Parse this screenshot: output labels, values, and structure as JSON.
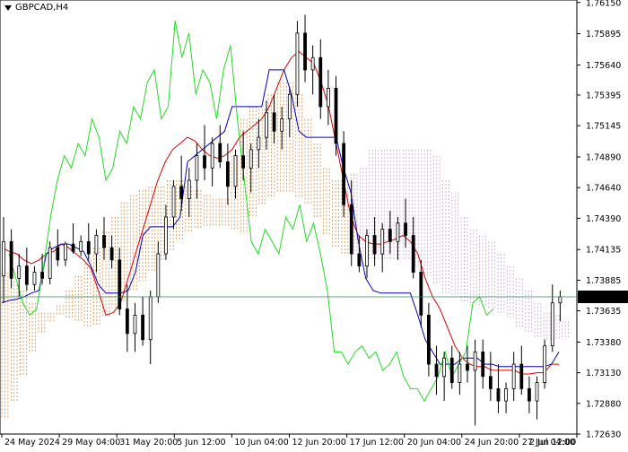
{
  "symbol_label": "GBPCAD,H4",
  "current_price": "1.73749",
  "colors": {
    "candles": "#000000",
    "tenkan": "#e00000",
    "kijun": "#0000c8",
    "chikou": "#22dd22",
    "senkou_a_cloud": "#e08a3c",
    "senkou_b_cloud": "#c8a0c8",
    "price_line": "#2e8b57",
    "price_label_bg": "#000000"
  },
  "chart_data": {
    "type": "line",
    "title": "GBPCAD,H4",
    "xlabel": "",
    "ylabel": "",
    "ylim": [
      1.7263,
      1.7617
    ],
    "y_ticks": [
      "1.76150",
      "1.75895",
      "1.75640",
      "1.75395",
      "1.75145",
      "1.74890",
      "1.74640",
      "1.74390",
      "1.74135",
      "1.73885",
      "1.73635",
      "1.73380",
      "1.73130",
      "1.72880",
      "1.72630"
    ],
    "x_ticks": [
      "24 May 2024",
      "29 May 04:00",
      "31 May 20:00",
      "5 Jun 12:00",
      "10 Jun 04:00",
      "12 Jun 20:00",
      "17 Jun 12:00",
      "20 Jun 04:00",
      "24 Jun 20:00",
      "27 Jun 12:00",
      "2 Jul 04:00"
    ],
    "x_range": [
      0,
      120
    ],
    "series": [
      {
        "values": [
          1.7415,
          1.7412,
          1.741,
          1.7405,
          1.7402,
          1.7405,
          1.741,
          1.7412,
          1.7418,
          1.7415,
          1.741,
          1.7405,
          1.7398,
          1.738,
          1.736,
          1.7362,
          1.737,
          1.739,
          1.741,
          1.743,
          1.745,
          1.747,
          1.7485,
          1.7495,
          1.75,
          1.7505,
          1.7502,
          1.7495,
          1.749,
          1.7488,
          1.749,
          1.7495,
          1.7505,
          1.751,
          1.7515,
          1.752,
          1.753,
          1.7545,
          1.756,
          1.757,
          1.7575,
          1.757,
          1.7565,
          1.755,
          1.753,
          1.75,
          1.747,
          1.744,
          1.7425,
          1.742,
          1.7418,
          1.7418,
          1.742,
          1.7422,
          1.7425,
          1.742,
          1.741,
          1.739,
          1.7375,
          1.7365,
          1.735,
          1.7335,
          1.7325,
          1.732,
          1.7318,
          1.7318,
          1.7315,
          1.7315,
          1.7315,
          1.7315,
          1.7312,
          1.7312,
          1.7313,
          1.7313,
          1.732,
          1.732
        ]
      },
      {
        "values": [
          1.737,
          1.7372,
          1.7373,
          1.7375,
          1.7378,
          1.738,
          1.741,
          1.7415,
          1.7418,
          1.7418,
          1.7415,
          1.7412,
          1.74,
          1.7385,
          1.7378,
          1.7378,
          1.7378,
          1.738,
          1.7395,
          1.7425,
          1.7432,
          1.7432,
          1.7432,
          1.7432,
          1.744,
          1.7485,
          1.749,
          1.7495,
          1.75,
          1.7505,
          1.751,
          1.753,
          1.753,
          1.753,
          1.753,
          1.753,
          1.756,
          1.756,
          1.756,
          1.754,
          1.751,
          1.7505,
          1.7505,
          1.7505,
          1.7505,
          1.7505,
          1.748,
          1.746,
          1.742,
          1.739,
          1.738,
          1.7378,
          1.7378,
          1.7378,
          1.7378,
          1.7378,
          1.736,
          1.734,
          1.733,
          1.732,
          1.732,
          1.732,
          1.7325,
          1.7325,
          1.7325,
          1.732,
          1.732,
          1.7318,
          1.7318,
          1.7318,
          1.7318,
          1.7318,
          1.7318,
          1.7318,
          1.732,
          1.733
        ]
      },
      {
        "values": [
          1.741,
          1.739,
          1.737,
          1.736,
          1.7365,
          1.74,
          1.744,
          1.747,
          1.749,
          1.748,
          1.75,
          1.749,
          1.752,
          1.7505,
          1.747,
          1.748,
          1.751,
          1.75,
          1.753,
          1.752,
          1.755,
          1.756,
          1.752,
          1.753,
          1.76,
          1.757,
          1.759,
          1.754,
          1.756,
          1.755,
          1.752,
          1.756,
          1.758,
          1.752,
          1.747,
          1.742,
          1.741,
          1.743,
          1.742,
          1.741,
          1.744,
          1.743,
          1.745,
          1.742,
          1.7435,
          1.741,
          1.738,
          1.733,
          1.733,
          1.732,
          1.733,
          1.7335,
          1.7325,
          1.733,
          1.7315,
          1.732,
          1.733,
          1.731,
          1.73,
          1.73,
          1.729,
          1.73,
          1.731,
          1.733,
          1.731,
          1.732,
          1.733,
          1.737,
          1.7375,
          1.736,
          1.7365
        ]
      }
    ],
    "candles": [
      {
        "o": 1.7392,
        "h": 1.744,
        "l": 1.737,
        "c": 1.742
      },
      {
        "o": 1.742,
        "h": 1.743,
        "l": 1.7382,
        "c": 1.739
      },
      {
        "o": 1.739,
        "h": 1.741,
        "l": 1.7375,
        "c": 1.74
      },
      {
        "o": 1.74,
        "h": 1.7415,
        "l": 1.738,
        "c": 1.7385
      },
      {
        "o": 1.7385,
        "h": 1.74,
        "l": 1.738,
        "c": 1.7395
      },
      {
        "o": 1.7395,
        "h": 1.741,
        "l": 1.7385,
        "c": 1.739
      },
      {
        "o": 1.739,
        "h": 1.742,
        "l": 1.7385,
        "c": 1.7415
      },
      {
        "o": 1.7415,
        "h": 1.743,
        "l": 1.74,
        "c": 1.7405
      },
      {
        "o": 1.7405,
        "h": 1.742,
        "l": 1.74,
        "c": 1.7418
      },
      {
        "o": 1.7418,
        "h": 1.7435,
        "l": 1.741,
        "c": 1.7412
      },
      {
        "o": 1.7412,
        "h": 1.7425,
        "l": 1.7408,
        "c": 1.742
      },
      {
        "o": 1.742,
        "h": 1.7435,
        "l": 1.7405,
        "c": 1.741
      },
      {
        "o": 1.741,
        "h": 1.743,
        "l": 1.7395,
        "c": 1.7425
      },
      {
        "o": 1.7425,
        "h": 1.744,
        "l": 1.7405,
        "c": 1.7415
      },
      {
        "o": 1.7415,
        "h": 1.7425,
        "l": 1.7398,
        "c": 1.7405
      },
      {
        "o": 1.7405,
        "h": 1.7415,
        "l": 1.736,
        "c": 1.7365
      },
      {
        "o": 1.7365,
        "h": 1.7385,
        "l": 1.733,
        "c": 1.7345
      },
      {
        "o": 1.7345,
        "h": 1.737,
        "l": 1.733,
        "c": 1.736
      },
      {
        "o": 1.736,
        "h": 1.7375,
        "l": 1.7335,
        "c": 1.734
      },
      {
        "o": 1.734,
        "h": 1.738,
        "l": 1.732,
        "c": 1.7375
      },
      {
        "o": 1.7375,
        "h": 1.742,
        "l": 1.737,
        "c": 1.741
      },
      {
        "o": 1.741,
        "h": 1.745,
        "l": 1.7405,
        "c": 1.744
      },
      {
        "o": 1.744,
        "h": 1.747,
        "l": 1.743,
        "c": 1.7465
      },
      {
        "o": 1.7465,
        "h": 1.749,
        "l": 1.7445,
        "c": 1.7455
      },
      {
        "o": 1.7455,
        "h": 1.748,
        "l": 1.744,
        "c": 1.747
      },
      {
        "o": 1.747,
        "h": 1.75,
        "l": 1.7455,
        "c": 1.749
      },
      {
        "o": 1.749,
        "h": 1.7515,
        "l": 1.747,
        "c": 1.748
      },
      {
        "o": 1.748,
        "h": 1.7505,
        "l": 1.7465,
        "c": 1.75
      },
      {
        "o": 1.75,
        "h": 1.7515,
        "l": 1.748,
        "c": 1.7485
      },
      {
        "o": 1.7485,
        "h": 1.75,
        "l": 1.745,
        "c": 1.7465
      },
      {
        "o": 1.7465,
        "h": 1.7495,
        "l": 1.7455,
        "c": 1.749
      },
      {
        "o": 1.749,
        "h": 1.751,
        "l": 1.747,
        "c": 1.748
      },
      {
        "o": 1.748,
        "h": 1.75,
        "l": 1.746,
        "c": 1.7495
      },
      {
        "o": 1.7495,
        "h": 1.752,
        "l": 1.748,
        "c": 1.7505
      },
      {
        "o": 1.7505,
        "h": 1.7535,
        "l": 1.7495,
        "c": 1.7525
      },
      {
        "o": 1.7525,
        "h": 1.754,
        "l": 1.75,
        "c": 1.751
      },
      {
        "o": 1.751,
        "h": 1.753,
        "l": 1.7495,
        "c": 1.752
      },
      {
        "o": 1.752,
        "h": 1.7545,
        "l": 1.7505,
        "c": 1.754
      },
      {
        "o": 1.754,
        "h": 1.76,
        "l": 1.753,
        "c": 1.759
      },
      {
        "o": 1.759,
        "h": 1.7605,
        "l": 1.755,
        "c": 1.756
      },
      {
        "o": 1.756,
        "h": 1.758,
        "l": 1.754,
        "c": 1.757
      },
      {
        "o": 1.757,
        "h": 1.7585,
        "l": 1.752,
        "c": 1.753
      },
      {
        "o": 1.753,
        "h": 1.756,
        "l": 1.7515,
        "c": 1.7545
      },
      {
        "o": 1.7545,
        "h": 1.7555,
        "l": 1.749,
        "c": 1.75
      },
      {
        "o": 1.75,
        "h": 1.751,
        "l": 1.744,
        "c": 1.745
      },
      {
        "o": 1.745,
        "h": 1.747,
        "l": 1.74,
        "c": 1.741
      },
      {
        "o": 1.741,
        "h": 1.7425,
        "l": 1.7395,
        "c": 1.74
      },
      {
        "o": 1.74,
        "h": 1.743,
        "l": 1.739,
        "c": 1.7425
      },
      {
        "o": 1.7425,
        "h": 1.744,
        "l": 1.74,
        "c": 1.741
      },
      {
        "o": 1.741,
        "h": 1.7435,
        "l": 1.7395,
        "c": 1.743
      },
      {
        "o": 1.743,
        "h": 1.7445,
        "l": 1.741,
        "c": 1.742
      },
      {
        "o": 1.742,
        "h": 1.744,
        "l": 1.7405,
        "c": 1.7435
      },
      {
        "o": 1.7435,
        "h": 1.7455,
        "l": 1.7415,
        "c": 1.7425
      },
      {
        "o": 1.7425,
        "h": 1.744,
        "l": 1.739,
        "c": 1.7395
      },
      {
        "o": 1.7395,
        "h": 1.7405,
        "l": 1.735,
        "c": 1.736
      },
      {
        "o": 1.736,
        "h": 1.737,
        "l": 1.731,
        "c": 1.732
      },
      {
        "o": 1.732,
        "h": 1.7335,
        "l": 1.7295,
        "c": 1.731
      },
      {
        "o": 1.731,
        "h": 1.733,
        "l": 1.729,
        "c": 1.7325
      },
      {
        "o": 1.7325,
        "h": 1.7335,
        "l": 1.73,
        "c": 1.7305
      },
      {
        "o": 1.7305,
        "h": 1.733,
        "l": 1.7295,
        "c": 1.732
      },
      {
        "o": 1.732,
        "h": 1.7335,
        "l": 1.7305,
        "c": 1.7315
      },
      {
        "o": 1.7315,
        "h": 1.734,
        "l": 1.727,
        "c": 1.733
      },
      {
        "o": 1.733,
        "h": 1.734,
        "l": 1.73,
        "c": 1.731
      },
      {
        "o": 1.731,
        "h": 1.733,
        "l": 1.729,
        "c": 1.73
      },
      {
        "o": 1.73,
        "h": 1.732,
        "l": 1.728,
        "c": 1.729
      },
      {
        "o": 1.729,
        "h": 1.7305,
        "l": 1.728,
        "c": 1.73
      },
      {
        "o": 1.73,
        "h": 1.733,
        "l": 1.729,
        "c": 1.732
      },
      {
        "o": 1.732,
        "h": 1.7335,
        "l": 1.7295,
        "c": 1.73
      },
      {
        "o": 1.73,
        "h": 1.731,
        "l": 1.728,
        "c": 1.729
      },
      {
        "o": 1.729,
        "h": 1.731,
        "l": 1.7275,
        "c": 1.7305
      },
      {
        "o": 1.7305,
        "h": 1.734,
        "l": 1.73,
        "c": 1.7335
      },
      {
        "o": 1.7335,
        "h": 1.7385,
        "l": 1.733,
        "c": 1.737
      },
      {
        "o": 1.737,
        "h": 1.738,
        "l": 1.7355,
        "c": 1.7375
      }
    ]
  }
}
